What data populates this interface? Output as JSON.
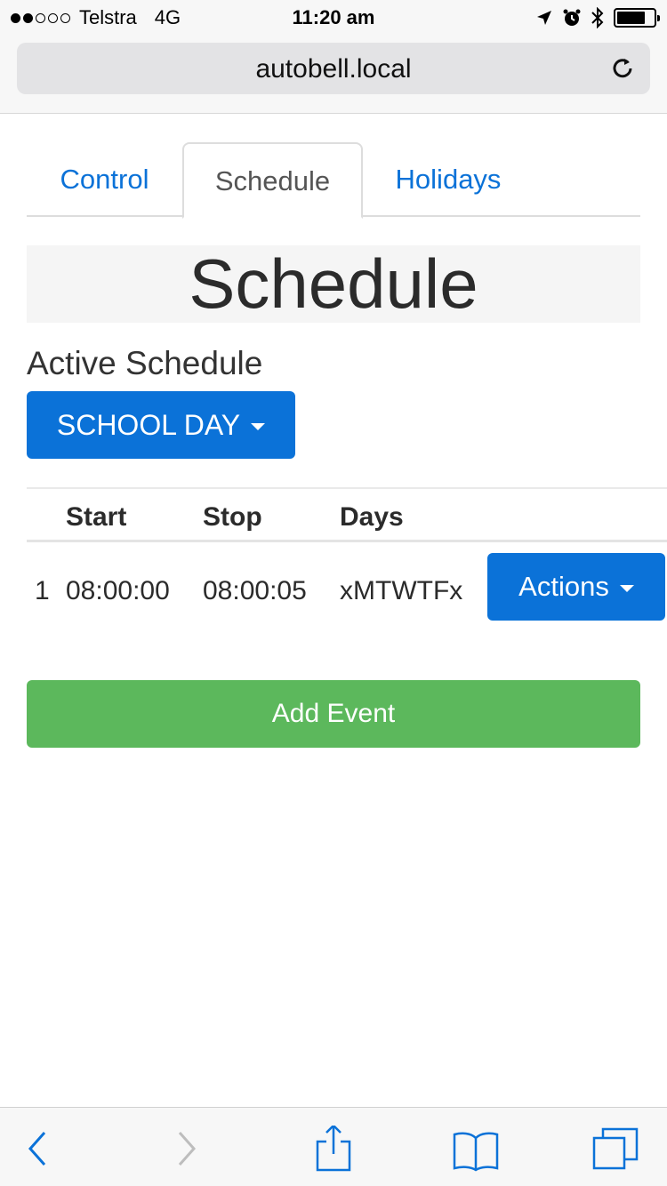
{
  "status_bar": {
    "carrier": "Telstra",
    "network": "4G",
    "time": "11:20 am",
    "signal_bars_filled": 2,
    "signal_bars_total": 5,
    "icons": [
      "location-icon",
      "alarm-icon",
      "bluetooth-icon",
      "battery-icon"
    ]
  },
  "browser": {
    "url": "autobell.local",
    "reload_icon": "reload-icon"
  },
  "tabs": [
    {
      "label": "Control",
      "active": false
    },
    {
      "label": "Schedule",
      "active": true
    },
    {
      "label": "Holidays",
      "active": false
    }
  ],
  "page": {
    "title": "Schedule",
    "active_schedule_label": "Active Schedule",
    "active_schedule_value": "SCHOOL DAY"
  },
  "table": {
    "headers": [
      "",
      "Start",
      "Stop",
      "Days"
    ],
    "rows": [
      {
        "index": "1",
        "start": "08:00:00",
        "stop": "08:00:05",
        "days": "xMTWTFx",
        "action_label": "Actions"
      }
    ]
  },
  "add_event_label": "Add Event",
  "colors": {
    "primary": "#0b72d8",
    "success": "#5cb85c",
    "ios_tint": "#0b72d8"
  },
  "toolbar": {
    "icons": [
      "back-icon",
      "forward-icon",
      "share-icon",
      "bookmarks-icon",
      "tabs-icon"
    ]
  }
}
